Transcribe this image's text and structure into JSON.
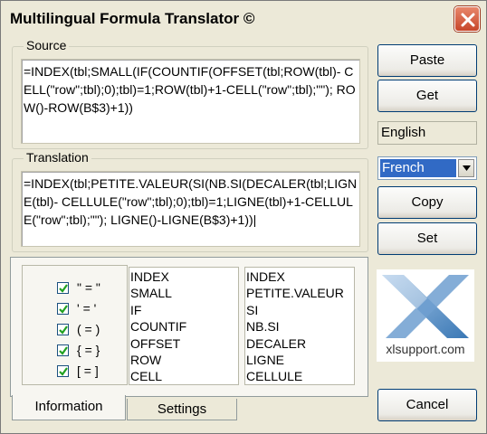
{
  "window": {
    "title": "Multilingual Formula Translator ©"
  },
  "source": {
    "label": "Source",
    "formula": "=INDEX(tbl;SMALL(IF(COUNTIF(OFFSET(tbl;ROW(tbl)- CELL(\"row\";tbl);0);tbl)=1;ROW(tbl)+1-CELL(\"row\";tbl);\"\"); ROW()-ROW(B$3)+1))"
  },
  "translation": {
    "label": "Translation",
    "formula": "=INDEX(tbl;PETITE.VALEUR(SI(NB.SI(DECALER(tbl;LIGNE(tbl)- CELLULE(\"row\";tbl);0);tbl)=1;LIGNE(tbl)+1-CELLULE(\"row\";tbl);\"\"); LIGNE()-LIGNE(B$3)+1))|"
  },
  "buttons": {
    "paste": "Paste",
    "get": "Get",
    "copy": "Copy",
    "set": "Set",
    "cancel": "Cancel"
  },
  "languages": {
    "source_language": "English",
    "target_language": "French"
  },
  "options": [
    {
      "label": "\" = \"",
      "checked": true
    },
    {
      "label": "' = '",
      "checked": true
    },
    {
      "label": "( = )",
      "checked": true
    },
    {
      "label": "{ = }",
      "checked": true
    },
    {
      "label": "[ = ]",
      "checked": true
    }
  ],
  "function_lists": {
    "english": [
      "INDEX",
      "SMALL",
      "IF",
      "COUNTIF",
      "OFFSET",
      "ROW",
      "CELL"
    ],
    "french": [
      "INDEX",
      "PETITE.VALEUR",
      "SI",
      "NB.SI",
      "DECALER",
      "LIGNE",
      "CELLULE"
    ]
  },
  "tabs": {
    "information": "Information",
    "settings": "Settings"
  },
  "logo": {
    "text": "xlsupport.com",
    "color": "#3a78b5"
  }
}
